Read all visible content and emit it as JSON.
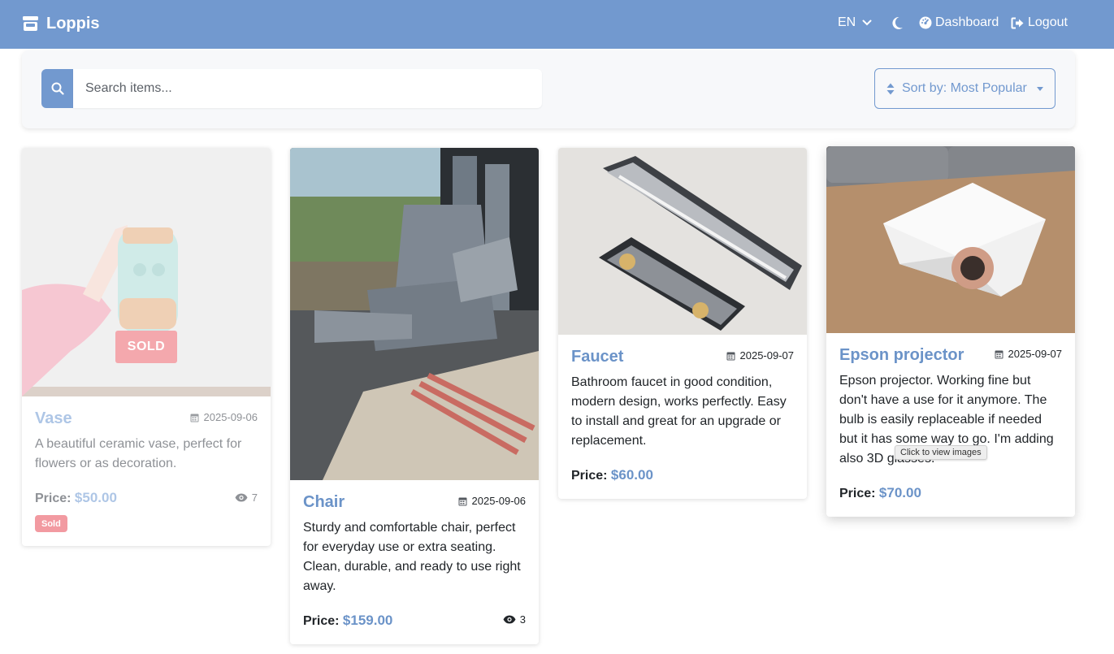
{
  "navbar": {
    "brand": "Loppis",
    "language": "EN",
    "dashboard_label": "Dashboard",
    "logout_label": "Logout",
    "color": "#7299cf"
  },
  "search": {
    "placeholder": "Search items...",
    "value": ""
  },
  "sort": {
    "label": "Sort by: Most Popular"
  },
  "price_label": "Price:",
  "items": [
    {
      "title": "Vase",
      "date": "2025-09-06",
      "description": "A beautiful ceramic vase, perfect for flowers or as decoration.",
      "price": "$50.00",
      "views": "7",
      "sold": true,
      "sold_overlay": "SOLD",
      "sold_badge": "Sold"
    },
    {
      "title": "Chair",
      "date": "2025-09-06",
      "description": "Sturdy and comfortable chair, perfect for everyday use or extra seating. Clean, durable, and ready to use right away.",
      "price": "$159.00",
      "views": "3",
      "sold": false
    },
    {
      "title": "Faucet",
      "date": "2025-09-07",
      "description": "Bathroom faucet in good condition, modern design, works perfectly. Easy to install and great for an upgrade or replacement.",
      "price": "$60.00",
      "sold": false
    },
    {
      "title": "Epson projector",
      "date": "2025-09-07",
      "description": "Epson projector. Working fine but don't have a use for it anymore. The bulb is easily replaceable if needed but it has some way to go. I'm adding also 3D glasses.",
      "price": "$70.00",
      "sold": false,
      "tooltip": "Click to view images"
    }
  ]
}
